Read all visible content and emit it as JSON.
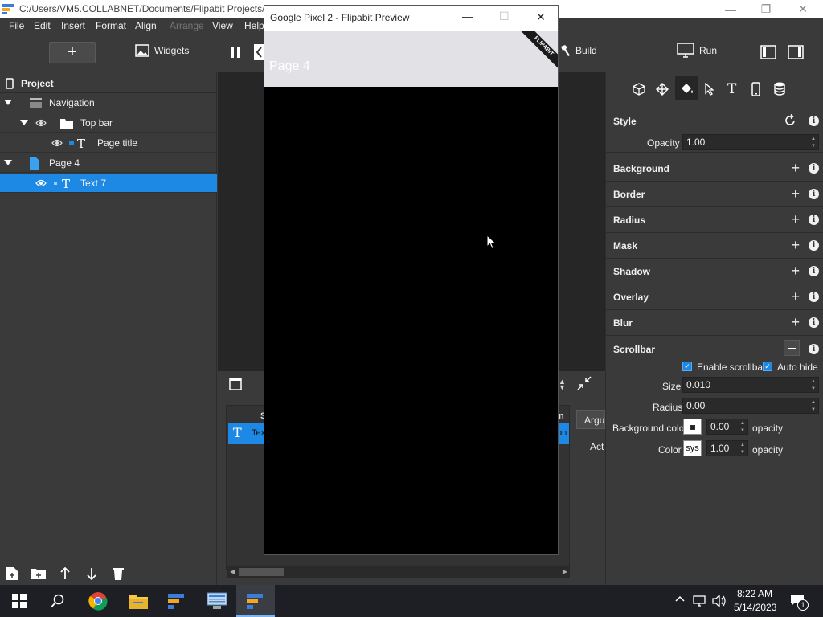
{
  "window": {
    "path": "C:/Users/VM5.COLLABNET/Documents/Flipabit Projects/&",
    "minimize": "—",
    "maximize": "❐",
    "close": "✕"
  },
  "menu": [
    "File",
    "Edit",
    "Insert",
    "Format",
    "Align",
    "Arrange",
    "View",
    "Help"
  ],
  "toolbar": {
    "add_label": "+",
    "widgets_label": "Widgets",
    "build_label": "Build",
    "run_label": "Run"
  },
  "project": {
    "title": "Project",
    "tree": [
      {
        "label": "Navigation"
      },
      {
        "label": "Top bar"
      },
      {
        "label": "Page title"
      },
      {
        "label": "Page 4"
      },
      {
        "label": "Text 7"
      }
    ]
  },
  "preview": {
    "title": "Google Pixel 2 - Flipabit Preview",
    "page_heading": "Page 4",
    "ribbon": "FLIPABIT",
    "minimize": "—",
    "maximize": "☐",
    "close": "✕"
  },
  "bottom": {
    "tab_args": "Argu",
    "actions_label": "Act",
    "col_s": "S",
    "col_n": "n",
    "row_text": "Tex",
    "row_text2": "on"
  },
  "style_panel": {
    "style_title": "Style",
    "opacity_label": "Opacity",
    "opacity_value": "1.00",
    "sections": [
      {
        "title": "Background"
      },
      {
        "title": "Border"
      },
      {
        "title": "Radius"
      },
      {
        "title": "Mask"
      },
      {
        "title": "Shadow"
      },
      {
        "title": "Overlay"
      },
      {
        "title": "Blur"
      }
    ],
    "scrollbar": {
      "title": "Scrollbar",
      "enable_label": "Enable scrollbar",
      "autohide_label": "Auto hide",
      "size_label": "Size",
      "size_value": "0.010",
      "radius_label": "Radius",
      "radius_value": "0.00",
      "bgcolor_label": "Background color",
      "bgcolor_value": "0.00",
      "bgcolor_opacity": "opacity",
      "color_label": "Color",
      "color_swatch": "sys",
      "color_value": "1.00",
      "color_opacity": "opacity"
    }
  },
  "taskbar": {
    "time": "8:22 AM",
    "date": "5/14/2023",
    "notif_count": "1"
  }
}
